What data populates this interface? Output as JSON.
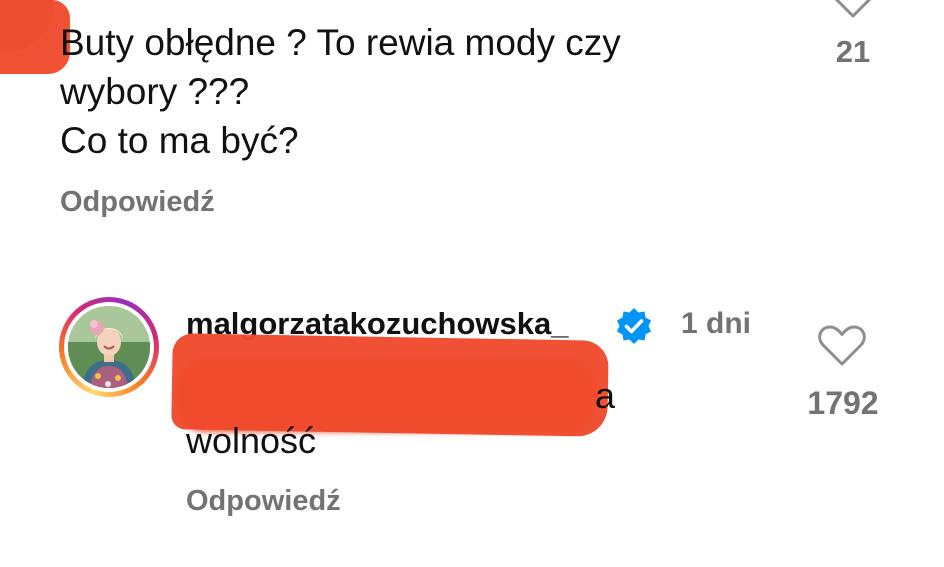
{
  "comments": [
    {
      "text_lines": [
        "Buty obłędne ? To rewia mody czy",
        "wybory ???",
        "Co to ma być?"
      ],
      "reply_label": "Odpowiedź",
      "like_count": "21"
    },
    {
      "username": "malgorzatakozuchowska_",
      "verified_icon": "verified-badge-icon",
      "timestamp": "1 dni",
      "mention_tail": "a",
      "text": "wolność",
      "reply_label": "Odpowiedź",
      "like_count": "1792"
    }
  ],
  "colors": {
    "text": "#111111",
    "muted": "#737373",
    "redaction": "#f04a2c",
    "verified": "#0095f6"
  }
}
